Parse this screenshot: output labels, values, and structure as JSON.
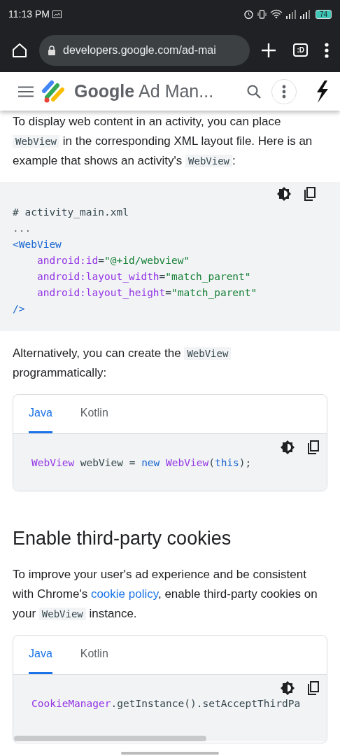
{
  "status_bar": {
    "time": "11:13 PM",
    "battery": "74"
  },
  "browser": {
    "url": "developers.google.com/ad-mai",
    "tab_count": ":D"
  },
  "site_header": {
    "brand": "Google",
    "product": "Ad Man..."
  },
  "content": [
    {
      "kind": "paragraph",
      "segments": [
        {
          "kind": "text",
          "text": "To display web content in an activity, you can place "
        },
        {
          "kind": "code",
          "text": "WebView"
        },
        {
          "kind": "text",
          "text": " in the corresponding XML layout file. Here is an example that shows an activity's "
        },
        {
          "kind": "code",
          "text": "WebView"
        },
        {
          "kind": "text",
          "text": ":"
        }
      ]
    },
    {
      "kind": "codeblock",
      "lines": [
        {
          "indent": false,
          "tokens": [
            {
              "kind": "plain",
              "text": "# activity_main.xml"
            }
          ]
        },
        {
          "indent": false,
          "tokens": [
            {
              "kind": "comment",
              "text": "..."
            }
          ]
        },
        {
          "indent": false,
          "tokens": [
            {
              "kind": "tag",
              "text": "<WebView"
            }
          ]
        },
        {
          "indent": true,
          "tokens": [
            {
              "kind": "attr",
              "text": "android:id"
            },
            {
              "kind": "plain",
              "text": "="
            },
            {
              "kind": "string",
              "text": "\"@+id/webview\""
            }
          ]
        },
        {
          "indent": true,
          "tokens": [
            {
              "kind": "attr",
              "text": "android:layout_width"
            },
            {
              "kind": "plain",
              "text": "="
            },
            {
              "kind": "string",
              "text": "\"match_parent\""
            }
          ]
        },
        {
          "indent": true,
          "tokens": [
            {
              "kind": "attr",
              "text": "android:layout_height"
            },
            {
              "kind": "plain",
              "text": "="
            },
            {
              "kind": "string",
              "text": "\"match_parent\""
            }
          ]
        },
        {
          "indent": false,
          "tokens": [
            {
              "kind": "tag",
              "text": "/>"
            }
          ]
        }
      ]
    },
    {
      "kind": "paragraph",
      "segments": [
        {
          "kind": "text",
          "text": "Alternatively, you can create the "
        },
        {
          "kind": "code",
          "text": "WebView"
        },
        {
          "kind": "text",
          "text": " programmatically:"
        }
      ]
    },
    {
      "kind": "tabbed_code",
      "tabs": [
        {
          "label": "Java",
          "selected": true
        },
        {
          "label": "Kotlin",
          "selected": false
        }
      ],
      "scrollable": false,
      "lines": [
        {
          "indent": false,
          "tokens": [
            {
              "kind": "attr",
              "text": "WebView"
            },
            {
              "kind": "plain",
              "text": " webView = "
            },
            {
              "kind": "tag",
              "text": "new "
            },
            {
              "kind": "attr",
              "text": "WebView"
            },
            {
              "kind": "plain",
              "text": "("
            },
            {
              "kind": "tag",
              "text": "this"
            },
            {
              "kind": "plain",
              "text": ");"
            }
          ]
        }
      ]
    },
    {
      "kind": "heading",
      "text": "Enable third-party cookies"
    },
    {
      "kind": "paragraph",
      "segments": [
        {
          "kind": "text",
          "text": "To improve your user's ad experience and be consistent with Chrome's "
        },
        {
          "kind": "link",
          "text": "cookie policy"
        },
        {
          "kind": "text",
          "text": ", enable third-party cookies on your "
        },
        {
          "kind": "code",
          "text": "WebView"
        },
        {
          "kind": "text",
          "text": " instance."
        }
      ]
    },
    {
      "kind": "tabbed_code",
      "tabs": [
        {
          "label": "Java",
          "selected": true
        },
        {
          "label": "Kotlin",
          "selected": false
        }
      ],
      "scrollable": true,
      "lines": [
        {
          "indent": false,
          "tokens": [
            {
              "kind": "attr",
              "text": "CookieManager"
            },
            {
              "kind": "plain",
              "text": ".getInstance().setAcceptThirdPa"
            }
          ]
        }
      ]
    }
  ]
}
